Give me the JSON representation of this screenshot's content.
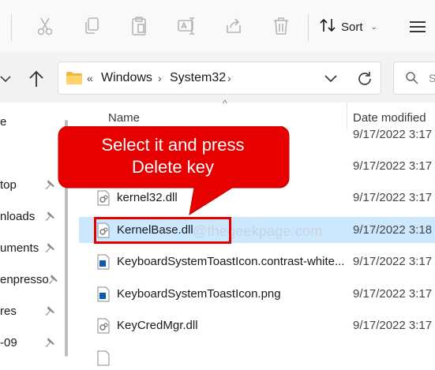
{
  "toolbar": {
    "sort_label": "Sort",
    "icons": [
      "cut-icon",
      "copy-icon",
      "paste-icon",
      "rename-icon",
      "share-icon",
      "delete-icon",
      "sort-icon",
      "view-icon"
    ]
  },
  "address": {
    "overflow_marker": "«",
    "breadcrumbs": [
      "Windows",
      "System32"
    ],
    "separator": "›"
  },
  "search": {
    "placeholder": "S"
  },
  "nav": {
    "items": [
      {
        "label": "e",
        "pinned": false
      },
      {
        "label": "top",
        "pinned": true
      },
      {
        "label": "nloads",
        "pinned": true
      },
      {
        "label": "uments",
        "pinned": true
      },
      {
        "label": "enpresso",
        "pinned": true
      },
      {
        "label": "res",
        "pinned": true
      },
      {
        "label": "-09",
        "pinned": true
      }
    ]
  },
  "columns": {
    "name": "Name",
    "date_modified": "Date modified"
  },
  "files": [
    {
      "name": "",
      "date": "9/17/2022 3:17",
      "icon": "dll-icon",
      "selected": false
    },
    {
      "name": "",
      "date": "9/17/2022 3:17",
      "icon": "dll-icon",
      "selected": false
    },
    {
      "name": "kernel32.dll",
      "date": "9/17/2022 3:17",
      "icon": "dll-icon",
      "selected": false
    },
    {
      "name": "KernelBase.dll",
      "date": "9/17/2022 3:18",
      "icon": "dll-icon",
      "selected": true
    },
    {
      "name": "KeyboardSystemToastIcon.contrast-white...",
      "date": "9/17/2022 3:17",
      "icon": "image-icon",
      "selected": false
    },
    {
      "name": "KeyboardSystemToastIcon.png",
      "date": "9/17/2022 3:17",
      "icon": "image-icon",
      "selected": false
    },
    {
      "name": "KeyCredMgr.dll",
      "date": "9/17/2022 3:17",
      "icon": "dll-icon",
      "selected": false
    }
  ],
  "callout": {
    "line1": "Select it and press",
    "line2": "Delete key"
  },
  "watermark": "@thegeekpage.com",
  "colors": {
    "selection": "#cce8ff",
    "callout": "#e60000",
    "highlight": "#e00000",
    "accent": "#0067c0"
  }
}
